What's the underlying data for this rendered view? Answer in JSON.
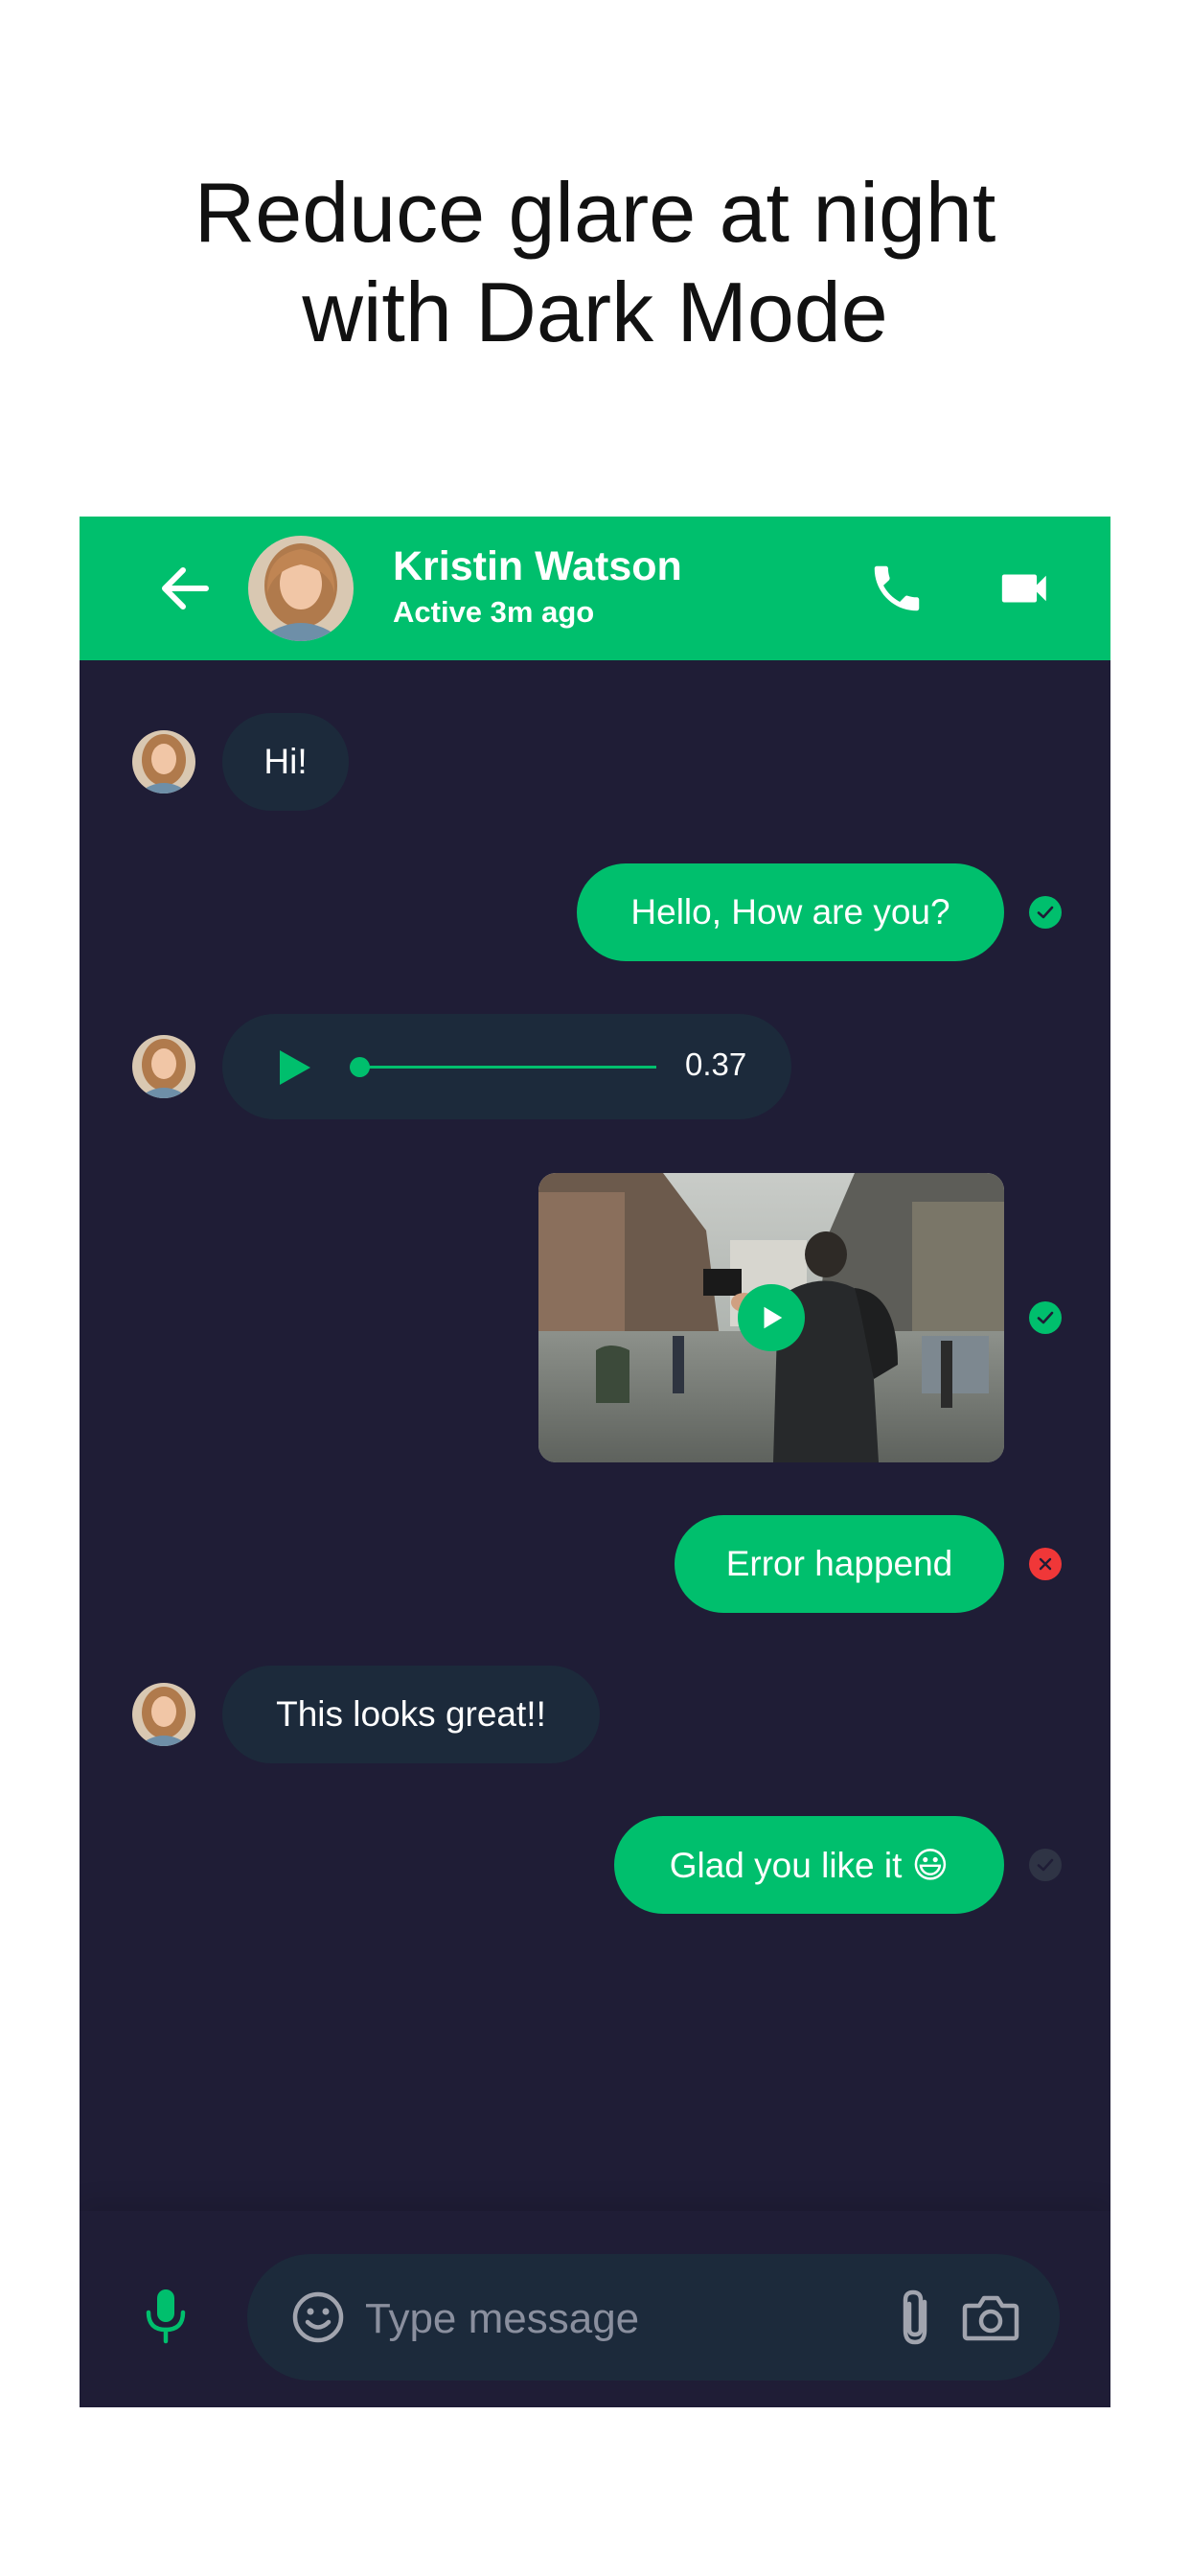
{
  "headline": {
    "line1": "Reduce glare at night",
    "line2": "with Dark Mode"
  },
  "appbar": {
    "contact_name": "Kristin Watson",
    "contact_status": "Active 3m ago",
    "icons": [
      "back-arrow-icon",
      "phone-icon",
      "video-camera-icon"
    ]
  },
  "messages": [
    {
      "direction": "incoming",
      "type": "text",
      "text": "Hi!"
    },
    {
      "direction": "outgoing",
      "type": "text",
      "text": "Hello, How are you?",
      "status": "viewed"
    },
    {
      "direction": "incoming",
      "type": "audio",
      "duration": "0.37",
      "progress": 0.0
    },
    {
      "direction": "outgoing",
      "type": "video",
      "status": "viewed"
    },
    {
      "direction": "outgoing",
      "type": "text",
      "text": "Error happend",
      "status": "error"
    },
    {
      "direction": "incoming",
      "type": "text",
      "text": "This looks great!!"
    },
    {
      "direction": "outgoing",
      "type": "text",
      "text": "Glad you like it 😃",
      "status": "not-viewed"
    }
  ],
  "composer": {
    "placeholder": "Type message",
    "icons": [
      "microphone-icon",
      "emoji-icon",
      "attachment-icon",
      "camera-icon"
    ]
  },
  "colors": {
    "primary": "#00bf6d",
    "background": "#1f1d36",
    "bubble_incoming": "#1c2a3b",
    "error": "#f03738",
    "pending": "#2f3445"
  }
}
